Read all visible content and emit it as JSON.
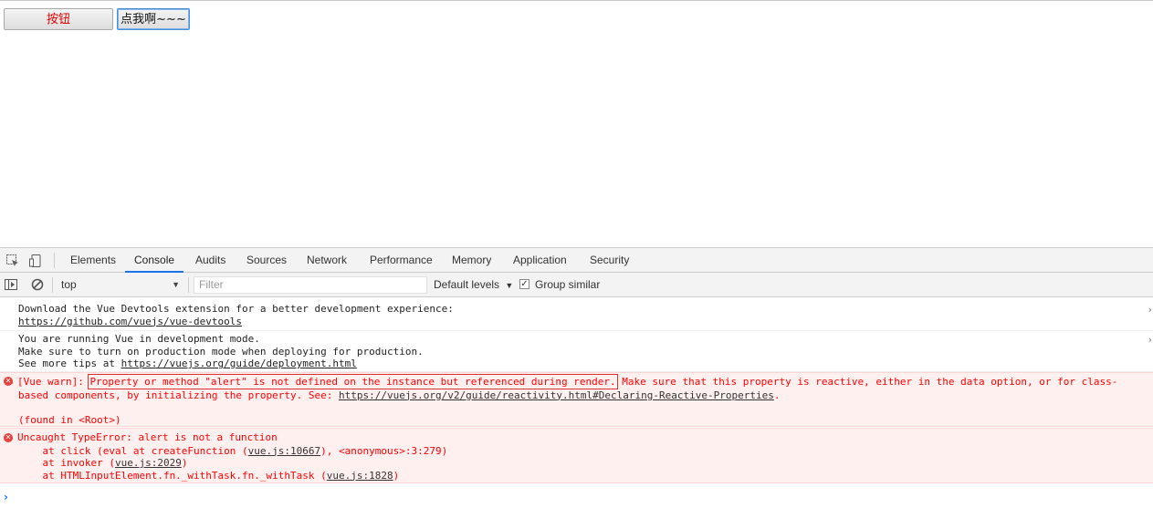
{
  "page": {
    "button1_label": "按钮",
    "button2_label": "点我啊~~~"
  },
  "devtools": {
    "tabs": [
      "Elements",
      "Console",
      "Audits",
      "Sources",
      "Network",
      "Performance",
      "Memory",
      "Application",
      "Security"
    ],
    "active_tab": "Console",
    "context": "top",
    "filter_placeholder": "Filter",
    "levels_label": "Default levels",
    "group_similar_label": "Group similar",
    "group_similar_checked": true
  },
  "console": {
    "msg1": {
      "text": "Download the Vue Devtools extension for a better development experience:",
      "link": "https://github.com/vuejs/vue-devtools"
    },
    "msg2": {
      "line1": "You are running Vue in development mode.",
      "line2": "Make sure to turn on production mode when deploying for production.",
      "line3_prefix": "See more tips at ",
      "line3_link": "https://vuejs.org/guide/deployment.html"
    },
    "warn": {
      "prefix": "[Vue warn]: ",
      "highlight": "Property or method \"alert\" is not defined on the instance but referenced during render.",
      "rest1": " Make sure that this property is reactive, either in the data option, or for class-",
      "rest2": "based components, by initializing the property. See: ",
      "link": "https://vuejs.org/v2/guide/reactivity.html#Declaring-Reactive-Properties",
      "period": ".",
      "found": "(found in <Root>)"
    },
    "error": {
      "title": "Uncaught TypeError: alert is not a function",
      "s1_pre": "    at click (eval at createFunction (",
      "s1_link": "vue.js:10667",
      "s1_post": "), <anonymous>:3:279)",
      "s2_pre": "    at invoker (",
      "s2_link": "vue.js:2029",
      "s2_post": ")",
      "s3_pre": "    at HTMLInputElement.fn._withTask.fn._withTask (",
      "s3_link": "vue.js:1828",
      "s3_post": ")"
    },
    "prompt": "›"
  },
  "colors": {
    "error_text": "#ff0000",
    "error_bg": "#fff0f0",
    "accent": "#1a73e8"
  }
}
